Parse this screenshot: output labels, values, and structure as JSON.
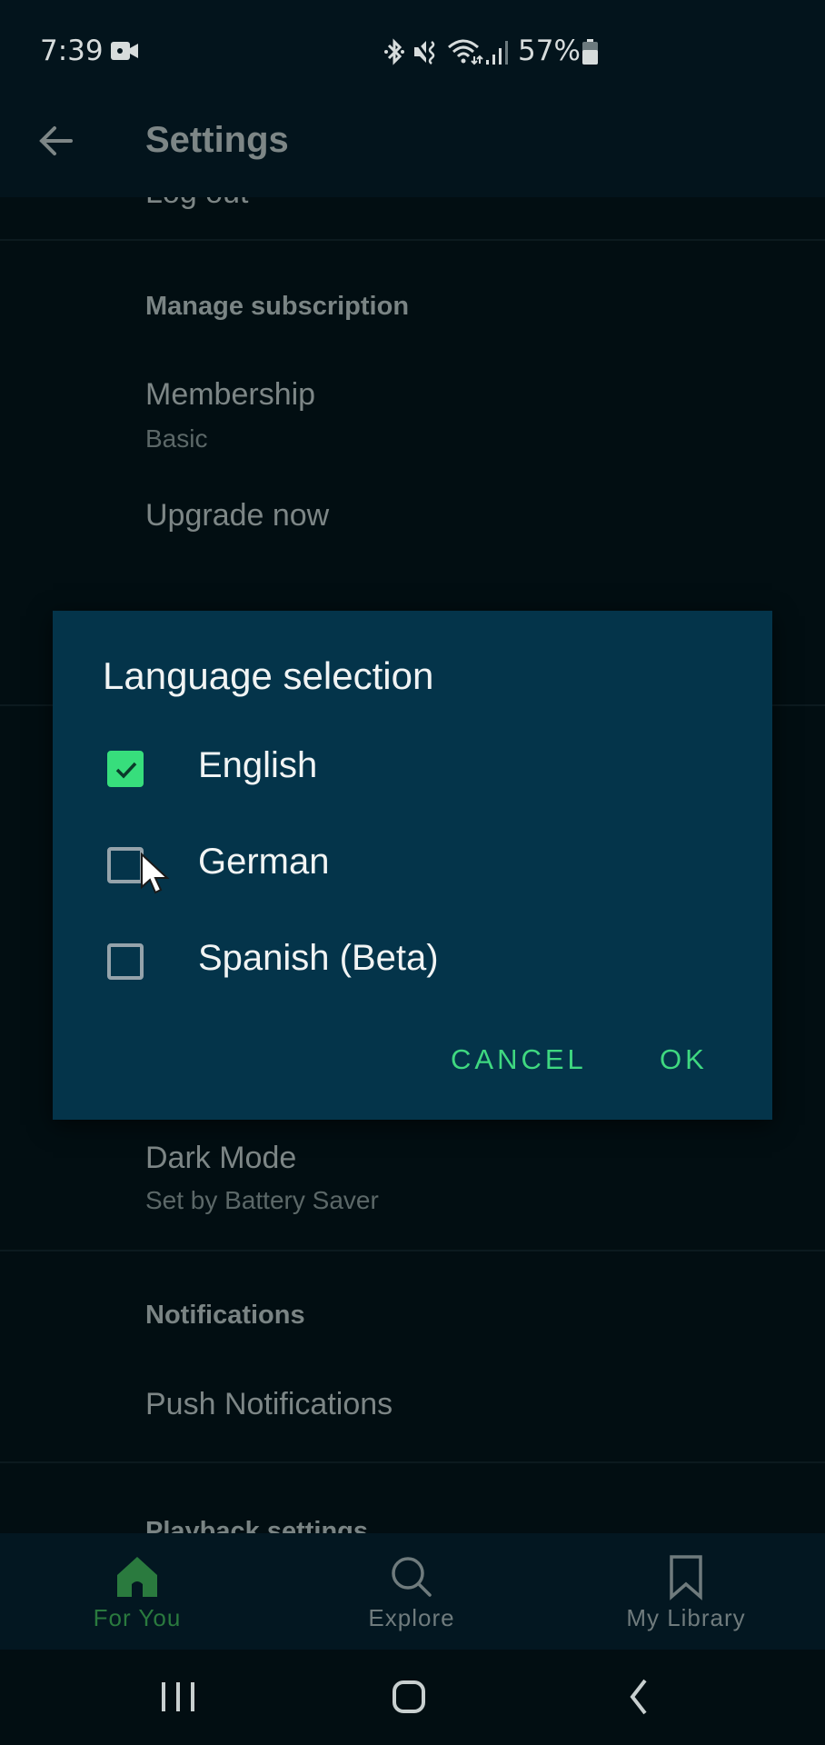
{
  "status_bar": {
    "time": "7:39",
    "battery_percent": "57%",
    "icons": [
      "video-camera-icon",
      "bluetooth-icon",
      "mute-vibrate-icon",
      "wifi-icon",
      "signal-icon",
      "battery-icon"
    ]
  },
  "app_bar": {
    "title": "Settings",
    "back_icon": "arrow-left-icon"
  },
  "settings": {
    "partial_item": "Log out",
    "sections": [
      {
        "header": "Manage subscription",
        "items": [
          {
            "title": "Membership",
            "subtitle": "Basic"
          },
          {
            "title": "Upgrade now"
          }
        ]
      },
      {
        "items": [
          {
            "title": "Dark Mode",
            "subtitle": "Set by Battery Saver"
          }
        ]
      },
      {
        "header": "Notifications",
        "items": [
          {
            "title": "Push Notifications"
          }
        ]
      },
      {
        "header": "Playback settings"
      }
    ]
  },
  "dialog": {
    "title": "Language selection",
    "options": [
      {
        "label": "English",
        "checked": true
      },
      {
        "label": "German",
        "checked": false
      },
      {
        "label": "Spanish (Beta)",
        "checked": false
      }
    ],
    "cancel_label": "CANCEL",
    "ok_label": "OK"
  },
  "bottom_nav": {
    "items": [
      {
        "label": "For You",
        "icon": "home-icon",
        "active": true
      },
      {
        "label": "Explore",
        "icon": "search-icon",
        "active": false
      },
      {
        "label": "My Library",
        "icon": "bookmark-icon",
        "active": false
      }
    ]
  },
  "system_nav": {
    "buttons": [
      "recent-apps-icon",
      "home-button-icon",
      "back-chevron-icon"
    ]
  },
  "colors": {
    "accent_green": "#37de7c",
    "dialog_bg": "#04344a",
    "active_nav": "#2a7a3e",
    "background": "#020e12"
  }
}
